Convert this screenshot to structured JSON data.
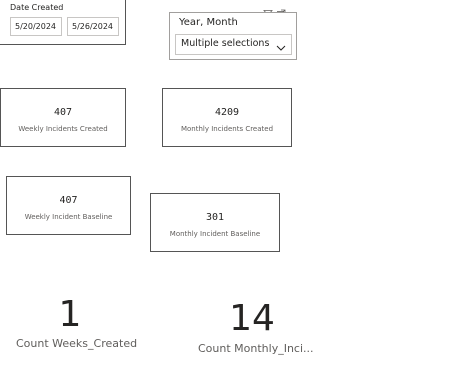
{
  "date_slicer": {
    "title": "Date Created",
    "start_date": "5/20/2024",
    "end_date": "5/26/2024"
  },
  "year_month_slicer": {
    "title": "Year, Month",
    "selected": "Multiple selections",
    "icons": [
      "filter-icon",
      "focus-mode-icon",
      "more-options-icon"
    ]
  },
  "cards": {
    "weekly_created": {
      "value": "407",
      "label": "Weekly Incidents Created"
    },
    "monthly_created": {
      "value": "4209",
      "label": "Monthly Incidents Created"
    },
    "weekly_baseline": {
      "value": "407",
      "label": "Weekly Incident Baseline"
    },
    "monthly_baseline": {
      "value": "301",
      "label": "Monthly Incident Baseline"
    }
  },
  "counts": {
    "weeks": {
      "value": "1",
      "label": "Count Weeks_Created"
    },
    "monthly": {
      "value": "14",
      "label": "Count Monthly_Inci..."
    }
  },
  "colors": {
    "border": "#555555",
    "text": "#252423",
    "subtext": "#605e5c"
  }
}
